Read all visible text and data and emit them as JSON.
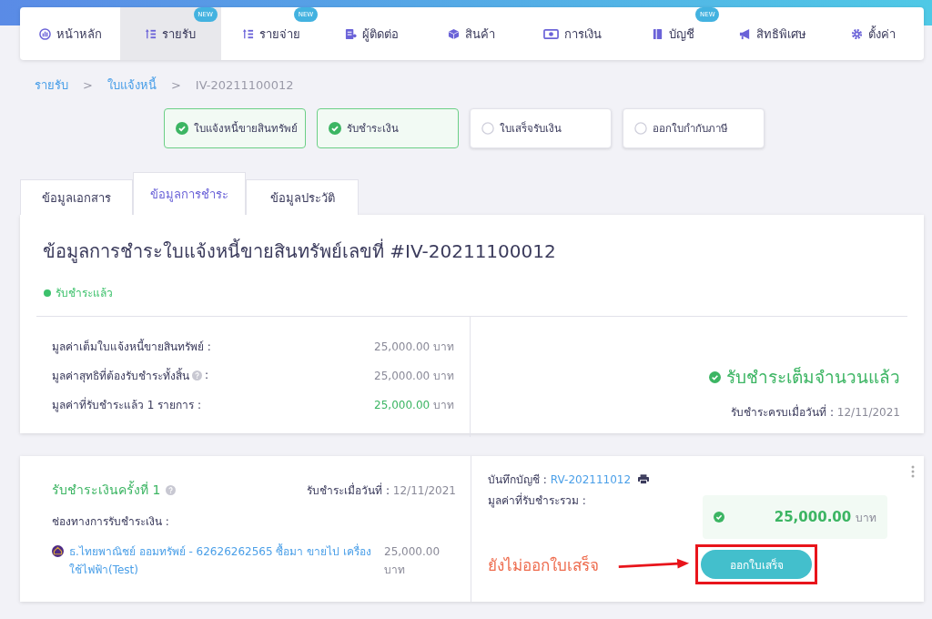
{
  "nav": {
    "items": [
      {
        "label": "หน้าหลัก",
        "selected": false
      },
      {
        "label": "รายรับ",
        "selected": true,
        "badge": "NEW"
      },
      {
        "label": "รายจ่าย",
        "selected": false,
        "badge": "NEW"
      },
      {
        "label": "ผู้ติดต่อ",
        "selected": false
      },
      {
        "label": "สินค้า",
        "selected": false
      },
      {
        "label": "การเงิน",
        "selected": false
      },
      {
        "label": "บัญชี",
        "selected": false,
        "badge": "NEW"
      },
      {
        "label": "สิทธิพิเศษ",
        "selected": false
      },
      {
        "label": "ตั้งค่า",
        "selected": false
      }
    ]
  },
  "breadcrumb": [
    {
      "kind": "link",
      "label": "รายรับ"
    },
    {
      "kind": "separator",
      "label": ">"
    },
    {
      "kind": "link",
      "label": "ใบแจ้งหนี้"
    },
    {
      "kind": "separator",
      "label": ">"
    },
    {
      "kind": "current",
      "label": "IV-20211100012"
    }
  ],
  "steps": [
    {
      "label": "ใบแจ้งหนี้ขายสินทรัพย์",
      "done": true
    },
    {
      "label": "รับชำระเงิน",
      "done": true
    },
    {
      "label": "ใบเสร็จรับเงิน",
      "done": false
    },
    {
      "label": "ออกใบกำกับภาษี",
      "done": false
    }
  ],
  "tabs": [
    {
      "label": "ข้อมูลเอกสาร",
      "selected": false
    },
    {
      "label": "ข้อมูลการชำระ",
      "selected": true
    },
    {
      "label": "ข้อมูลประวัติ",
      "selected": false
    }
  ],
  "summary": {
    "title": "ข้อมูลการชำระใบแจ้งหนี้ขายสินทรัพย์เลขที่ #IV-20211100012",
    "status": {
      "label": "รับชำระแล้ว",
      "color": "#3cc16b"
    },
    "rows": [
      {
        "label": "มูลค่าเต็มใบแจ้งหนี้ขายสินทรัพย์ :",
        "help": false,
        "value": "25,000.00",
        "unit": "บาท",
        "kind": "plain"
      },
      {
        "label": "มูลค่าสุทธิที่ต้องรับชำระทั้งสิ้น",
        "help": true,
        "value": "25,000.00",
        "unit": "บาท",
        "kind": "plain"
      },
      {
        "label": "มูลค่าที่รับชำระแล้ว 1 รายการ :",
        "help": false,
        "value": "25,000.00",
        "unit": "บาท",
        "kind": "paid"
      }
    ],
    "help_colon": ":",
    "headline": "รับชำระเต็มจำนวนแล้ว",
    "date_label": "รับชำระครบเมื่อวันที่ :",
    "date": "12/11/2021"
  },
  "payment": {
    "title": "รับชำระเงินครั้งที่ 1",
    "date_label": "รับชำระเมื่อวันที่ :",
    "date": "12/11/2021",
    "channel_label": "ช่องทางการรับชำระเงิน :",
    "channel": {
      "name": "ธ.ไทยพาณิชย์ ออมทรัพย์ - 62626262565 ซื้อมา ขายไป เครื่องใช้ไฟฟ้า(Test)",
      "amount": "25,000.00",
      "unit": "บาท"
    },
    "journal_label": "บันทึกบัญชี :",
    "journal_no": "RV-202111012",
    "total_label": "มูลค่าที่รับชำระรวม :",
    "total_amount": "25,000.00",
    "total_unit": "บาท",
    "annotation": "ยังไม่ออกใบเสร็จ",
    "button": "ออกใบเสร็จ"
  }
}
